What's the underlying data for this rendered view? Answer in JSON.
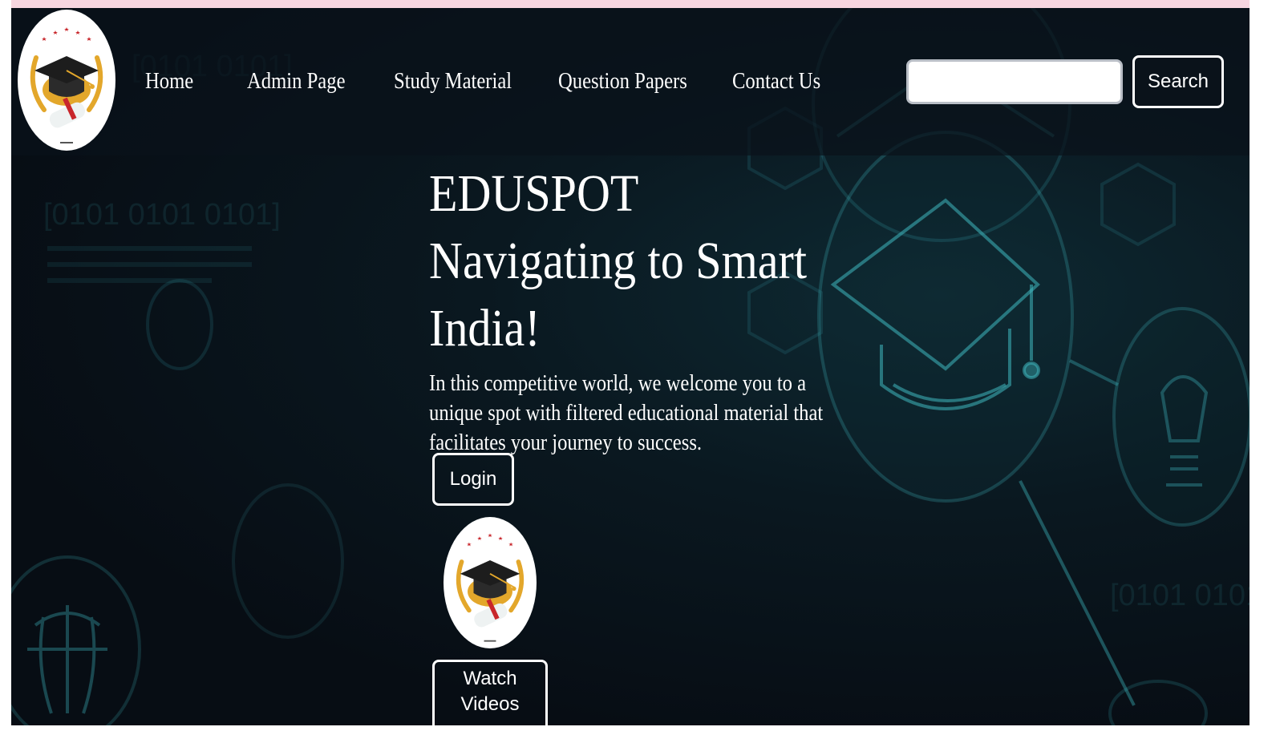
{
  "nav": {
    "links": [
      "Home",
      "Admin Page",
      "Study Material",
      "Question Papers",
      "Contact Us"
    ],
    "search_placeholder": "",
    "search_label": "Search"
  },
  "hero": {
    "title_line1": "EDUSPOT",
    "title_line2": "Navigating to Smart India!",
    "description": "In this competitive world, we welcome you to a unique spot with filtered educational material that facilitates your journey to success.",
    "login_label": "Login",
    "watch_label": "Watch Videos"
  },
  "icons": {
    "logo": "graduation-cap-laurel-logo",
    "background": "graduation-cap-network"
  },
  "colors": {
    "background": "#070d14",
    "accent_glow": "#3fb8c0",
    "text": "#ffffff",
    "pink_strip": "#f7d6e0"
  }
}
